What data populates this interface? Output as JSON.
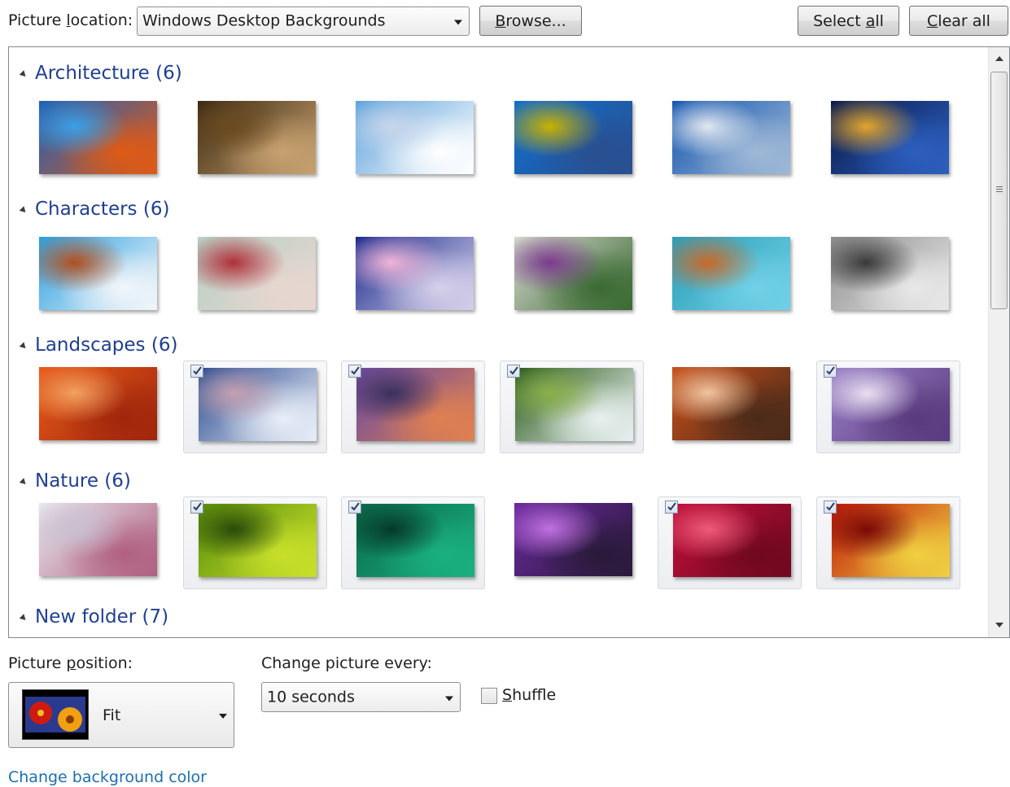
{
  "top": {
    "location_label_pre": "Picture ",
    "location_label_acc": "l",
    "location_label_post": "ocation:",
    "location_value": "Windows Desktop Backgrounds",
    "browse_acc": "B",
    "browse_rest": "rowse...",
    "select_all_pre": "Select ",
    "select_all_acc": "a",
    "select_all_post": "ll",
    "clear_all_acc": "C",
    "clear_all_post": "lear all"
  },
  "groups": [
    {
      "title": "Architecture (6)",
      "items": [
        {
          "checked": false,
          "colors": [
            "#1e60b8",
            "#e05a14",
            "#3a9fe6"
          ]
        },
        {
          "checked": false,
          "colors": [
            "#3c2a12",
            "#c7a170",
            "#6b4a20"
          ]
        },
        {
          "checked": false,
          "colors": [
            "#5ea2dc",
            "#ffffff",
            "#c8d6ea"
          ]
        },
        {
          "checked": false,
          "colors": [
            "#0f6fd0",
            "#2a4f8f",
            "#c8b200"
          ]
        },
        {
          "checked": false,
          "colors": [
            "#1356b0",
            "#9fb8d6",
            "#e2e8ef"
          ]
        },
        {
          "checked": false,
          "colors": [
            "#0a1a4a",
            "#2c5fbf",
            "#e3a52b"
          ]
        }
      ]
    },
    {
      "title": "Characters (6)",
      "items": [
        {
          "checked": false,
          "colors": [
            "#2a9fe0",
            "#f2f6fa",
            "#b05020"
          ]
        },
        {
          "checked": false,
          "colors": [
            "#b6d0c4",
            "#e8d6d0",
            "#b0303a"
          ]
        },
        {
          "checked": false,
          "colors": [
            "#1a2a8e",
            "#d6d0ea",
            "#f0b4d8"
          ]
        },
        {
          "checked": false,
          "colors": [
            "#d8d8d0",
            "#3a6a32",
            "#7a3a8e"
          ]
        },
        {
          "checked": false,
          "colors": [
            "#2a9eb8",
            "#70d0e6",
            "#c86a2a"
          ]
        },
        {
          "checked": false,
          "colors": [
            "#8c8c8c",
            "#e8e8e8",
            "#3a3a3a"
          ]
        }
      ]
    },
    {
      "title": "Landscapes (6)",
      "items": [
        {
          "checked": false,
          "colors": [
            "#e85a1a",
            "#a0260c",
            "#f2a060"
          ]
        },
        {
          "checked": true,
          "colors": [
            "#2a4a8e",
            "#e8eef8",
            "#c4a0b0"
          ]
        },
        {
          "checked": true,
          "colors": [
            "#6a4aa0",
            "#e08050",
            "#3a3060"
          ]
        },
        {
          "checked": true,
          "colors": [
            "#2a5a1a",
            "#e8f0f0",
            "#8ab04a"
          ]
        },
        {
          "checked": false,
          "colors": [
            "#c8501a",
            "#4a2a1a",
            "#f0c4a0"
          ]
        },
        {
          "checked": true,
          "colors": [
            "#9a80c8",
            "#5a3a7e",
            "#e8e0f0"
          ]
        }
      ]
    },
    {
      "title": "Nature (6)",
      "items": [
        {
          "checked": false,
          "colors": [
            "#e8e8ee",
            "#b06080",
            "#c8c0d0"
          ]
        },
        {
          "checked": true,
          "colors": [
            "#5a8e0a",
            "#c8e02a",
            "#2a4a0a"
          ]
        },
        {
          "checked": true,
          "colors": [
            "#0a6a4a",
            "#1ab080",
            "#053a2a"
          ]
        },
        {
          "checked": false,
          "colors": [
            "#6a2a9e",
            "#2a1a3a",
            "#c070e0"
          ]
        },
        {
          "checked": true,
          "colors": [
            "#c0103a",
            "#700820",
            "#f05a7a"
          ]
        },
        {
          "checked": true,
          "colors": [
            "#c01a0a",
            "#f0d040",
            "#7a0a05"
          ]
        }
      ]
    },
    {
      "title": "New folder (7)",
      "items": []
    }
  ],
  "bottom": {
    "position_label_pre": "Picture ",
    "position_label_acc": "p",
    "position_label_post": "osition:",
    "position_value": "Fit",
    "change_label_pre": "Chan",
    "change_label_acc": "g",
    "change_label_post": "e picture every:",
    "interval_value": "10 seconds",
    "shuffle_acc": "S",
    "shuffle_post": "huffle",
    "shuffle_checked": false,
    "bg_color_link": "Change background color"
  }
}
